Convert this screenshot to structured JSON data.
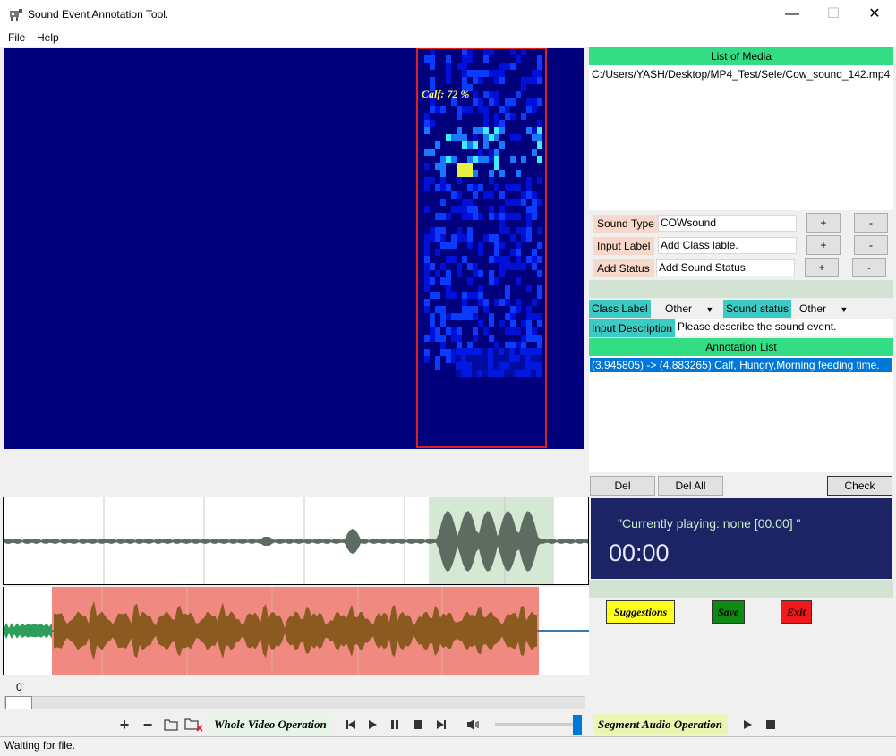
{
  "window": {
    "title": "Sound Event Annotation Tool.",
    "minimize": "—",
    "maximize": "☐",
    "close": "✕"
  },
  "menu": [
    "File",
    "Help"
  ],
  "spectrogram": {
    "detection_label": "Calf: 72 %"
  },
  "timeline": {
    "start_label": "0"
  },
  "toolbar": {
    "whole_video_label": "Whole Video Operation",
    "segment_audio_label": "Segment Audio Operation"
  },
  "status": "Waiting for file.",
  "right": {
    "media_header": "List of Media",
    "media_items": [
      "C:/Users/YASH/Desktop/MP4_Test/Sele/Cow_sound_142.mp4"
    ],
    "sound_type_label": "Sound Type",
    "sound_type_value": "COWsound",
    "input_label_label": "Input Label",
    "input_label_value": "Add Class lable.",
    "add_status_label": "Add Status",
    "add_status_value": "Add Sound Status.",
    "plus": "+",
    "minus": "-",
    "class_label_label": "Class Label",
    "class_label_value": "Other",
    "sound_status_label": "Sound status",
    "sound_status_value": "Other",
    "input_description_label": "Input Description",
    "input_description_value": "Please describe the sound event.",
    "annotation_header": "Annotation List",
    "annotations": [
      "(3.945805) -> (4.883265):Calf, Hungry,Morning feeding time."
    ],
    "del_label": "Del",
    "del_all_label": "Del All",
    "check_label": "Check",
    "now_playing": "\"Currently playing: none [00.00] \"",
    "clock": "00:00",
    "suggestions_label": "Suggestions",
    "save_label": "Save",
    "exit_label": "Exit"
  },
  "colors": {
    "accent_green": "#32dd84",
    "salmon_label": "#f9d8cc",
    "cyan_label": "#3ccbc4",
    "player_bg": "#1c2466",
    "spectrogram_bg": "#00007c",
    "selection_red": "#e02020",
    "selection_highlight": "#0078d7"
  }
}
